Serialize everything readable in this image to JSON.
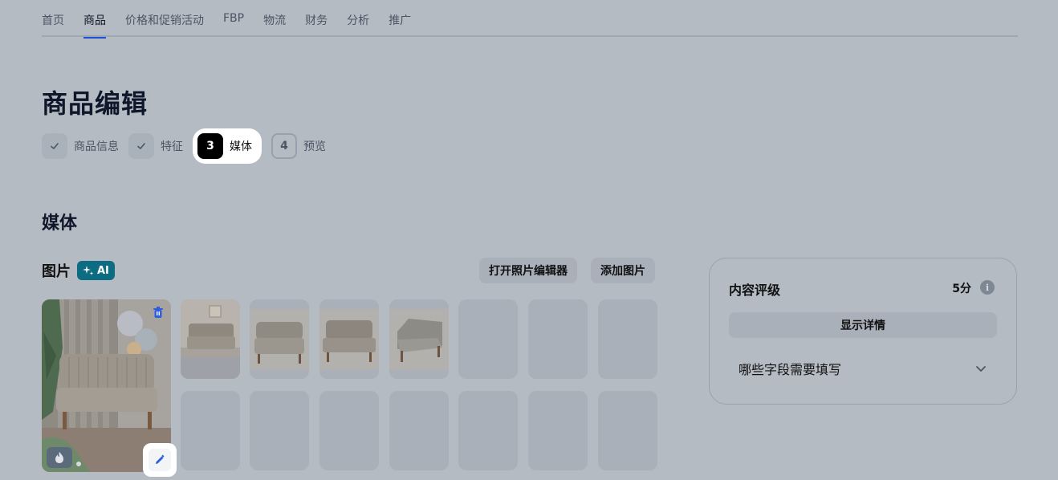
{
  "nav": {
    "items": [
      {
        "label": "首页"
      },
      {
        "label": "商品",
        "active": true
      },
      {
        "label": "价格和促销活动"
      },
      {
        "label": "FBP"
      },
      {
        "label": "物流"
      },
      {
        "label": "财务"
      },
      {
        "label": "分析"
      },
      {
        "label": "推广"
      }
    ],
    "accent_color": "#1e4fd6"
  },
  "page": {
    "title": "商品编辑"
  },
  "steps": [
    {
      "badge": "✓",
      "label": "商品信息",
      "state": "done"
    },
    {
      "badge": "✓",
      "label": "特征",
      "state": "done"
    },
    {
      "badge": "3",
      "label": "媒体",
      "state": "current"
    },
    {
      "badge": "4",
      "label": "预览",
      "state": "pending"
    }
  ],
  "media": {
    "section_title": "媒体",
    "images_label": "图片",
    "ai_badge": "AI",
    "open_editor_button": "打开照片编辑器",
    "add_image_button": "添加图片",
    "main_photo_icons": [
      "delete-icon",
      "fire-icon",
      "edit-icon"
    ],
    "thumbnails": [
      {
        "kind": "photo",
        "alt": "sofa-room"
      },
      {
        "kind": "photo",
        "alt": "sofa-front"
      },
      {
        "kind": "photo",
        "alt": "sofa-front-2"
      },
      {
        "kind": "photo",
        "alt": "sofa-side"
      },
      {
        "kind": "empty"
      },
      {
        "kind": "empty"
      },
      {
        "kind": "empty"
      },
      {
        "kind": "empty"
      },
      {
        "kind": "empty"
      },
      {
        "kind": "empty"
      },
      {
        "kind": "empty"
      },
      {
        "kind": "empty"
      },
      {
        "kind": "empty"
      },
      {
        "kind": "empty"
      }
    ]
  },
  "rating_panel": {
    "title": "内容评级",
    "score": "5分",
    "details_button": "显示详情",
    "fields_toggle": "哪些字段需要填写"
  }
}
